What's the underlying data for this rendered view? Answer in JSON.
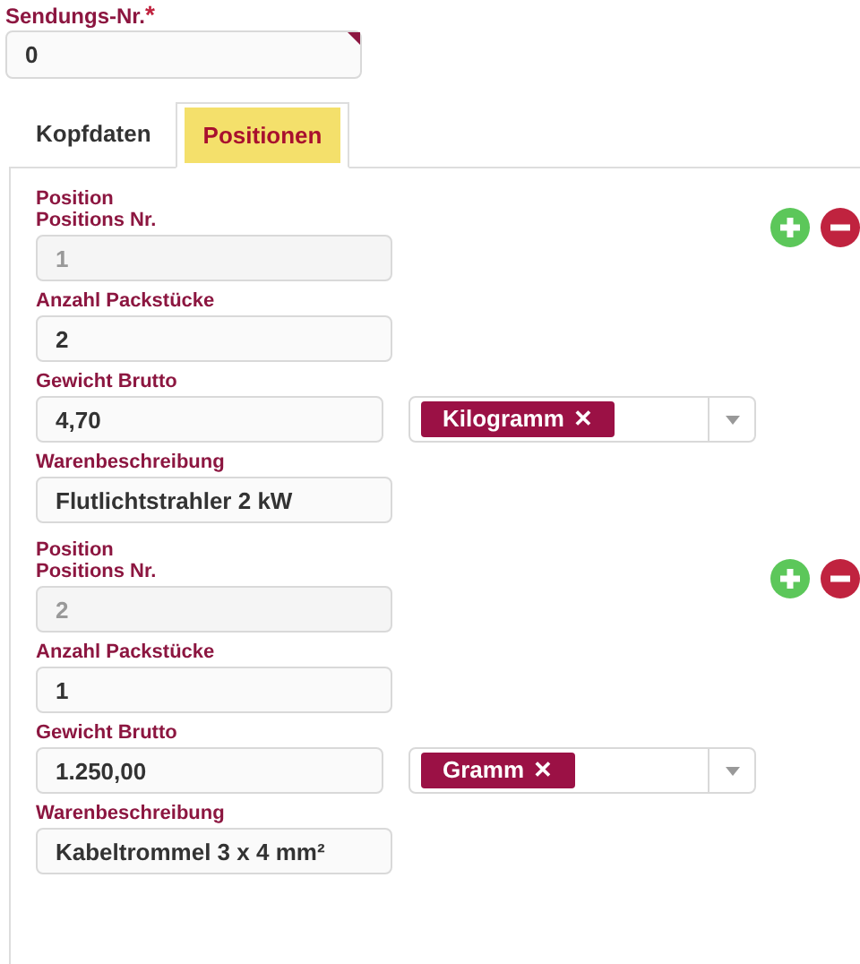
{
  "shipment_number": {
    "label": "Sendungs-Nr.",
    "required_mark": "*",
    "value": "0"
  },
  "tabs": [
    {
      "label": "Kopfdaten",
      "selected": false
    },
    {
      "label": "Positionen",
      "selected": true
    }
  ],
  "positions": [
    {
      "title": "Position",
      "number": {
        "label": "Positions Nr.",
        "value": "1",
        "disabled": true
      },
      "packages": {
        "label": "Anzahl Packstücke",
        "value": "2",
        "disabled": false
      },
      "weight": {
        "label": "Gewicht Brutto",
        "value": "4,70",
        "disabled": false
      },
      "unit": {
        "tag": "Kilogramm",
        "remove": "✕"
      },
      "description": {
        "label": "Warenbeschreibung",
        "value": "Flutlichtstrahler 2 kW",
        "disabled": false
      }
    },
    {
      "title": "Position",
      "number": {
        "label": "Positions Nr.",
        "value": "2",
        "disabled": true
      },
      "packages": {
        "label": "Anzahl Packstücke",
        "value": "1",
        "disabled": false
      },
      "weight": {
        "label": "Gewicht Brutto",
        "value": "1.250,00",
        "disabled": false
      },
      "unit": {
        "tag": "Gramm",
        "remove": "✕"
      },
      "description": {
        "label": "Warenbeschreibung",
        "value": "Kabeltrommel 3 x 4 mm²",
        "disabled": false
      }
    }
  ]
}
